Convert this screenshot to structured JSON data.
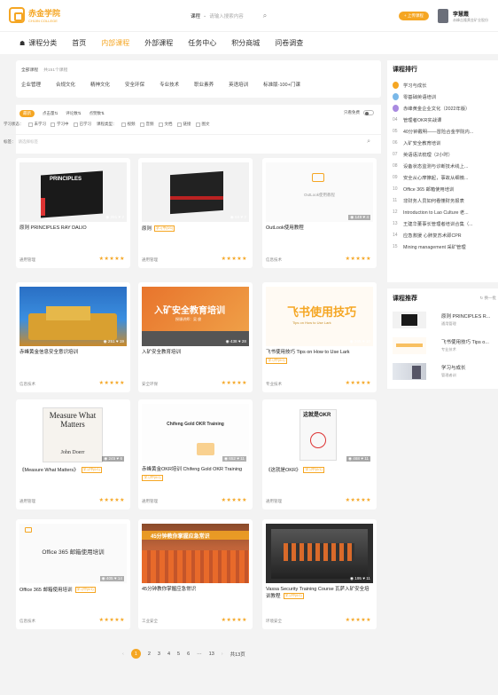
{
  "header": {
    "logo_title": "赤金学院",
    "logo_sub": "CHIJIN COLLEGE",
    "search_scope": "课程",
    "search_placeholder": "请输入搜索内容",
    "live_button": "+ 上传课程",
    "user_name": "李慧霞",
    "user_org": "赤峰吉隆黄金矿业股份"
  },
  "nav": {
    "items": [
      "课程分类",
      "首页",
      "内部课程",
      "外部课程",
      "任务中心",
      "积分商城",
      "问卷调查"
    ]
  },
  "filter": {
    "all_label": "全部课程",
    "count_text": "共151个课程",
    "categories": [
      "企业管理",
      "合规文化",
      "精神文化",
      "安全环保",
      "专业技术",
      "职业素养",
      "英语培训",
      "标准版-100+门课"
    ]
  },
  "sort": {
    "options": [
      "最新",
      "点击量⇅",
      "评论数⇅",
      "点赞数⇅"
    ],
    "only_free": "只看免费",
    "status_label": "学习状态：",
    "status_options": [
      "未学习",
      "学习中",
      "已学习"
    ],
    "type_label": "课程类型：",
    "type_options": [
      "视频",
      "音频",
      "文档",
      "链接",
      "图文"
    ],
    "tag_label": "标签：",
    "tag_placeholder": "请选择标签"
  },
  "courses": [
    {
      "title": "原则 PRINCIPLES RAY DALIO",
      "tag": "",
      "category": "通用管理",
      "views": "291",
      "likes": "2",
      "rating": 5
    },
    {
      "title": "原则",
      "tag": "学习中(0/1)",
      "category": "通用管理",
      "views": "66",
      "likes": "2",
      "rating": 5
    },
    {
      "title": "OutLook使用教程",
      "tag": "",
      "category": "信息技术",
      "views": "149",
      "likes": "4",
      "rating": 5
    },
    {
      "title": "赤峰黄金信息安全意识培训",
      "tag": "",
      "category": "信息技术",
      "views": "251",
      "likes": "19",
      "rating": 5
    },
    {
      "title": "入矿安全教育培训",
      "tag": "",
      "category": "安全环保",
      "views": "438",
      "likes": "28",
      "rating": 5
    },
    {
      "title": "飞书使用技巧 Tips on How to Use Lark",
      "tag": "学习中(0/1)",
      "category": "专业技术",
      "views": "265",
      "likes": "10",
      "rating": 5
    },
    {
      "title": "《Measure What Matters》",
      "tag": "学习中(0/1)",
      "category": "通用管理",
      "views": "245",
      "likes": "6",
      "rating": 5
    },
    {
      "title": "赤峰黄金OKR培训 Chifeng Gold OKR Training",
      "tag": "学习中(0/1)",
      "category": "通用管理",
      "views": "652",
      "likes": "11",
      "rating": 5
    },
    {
      "title": "《这就是OKR》",
      "tag": "学习中(0/1)",
      "category": "通用管理",
      "views": "468",
      "likes": "11",
      "rating": 5
    },
    {
      "title": "Office 365 邮箱使用培训",
      "tag": "学习中(0/1)",
      "category": "信息技术",
      "views": "405",
      "likes": "14",
      "rating": 5
    },
    {
      "title": "45分钟教你掌握应急常识",
      "tag": "",
      "category": "工业安全",
      "views": "",
      "likes": "",
      "rating": 5
    },
    {
      "title": "Vassa Security Training Course 瓦萨入矿安全培训教程",
      "tag": "学习中(0/1)",
      "category": "环境安全",
      "views": "195",
      "likes": "11",
      "rating": 5
    }
  ],
  "thumb_text": {
    "c1": "PRINCIPLES",
    "c3": "OutLook使用教程",
    "c5": "入矿安全教育培训",
    "c5_sub": "授课讲师：吴  俊",
    "c6": "飞书使用技巧",
    "c6_sub": "Tips on How to Use Lark",
    "c7": "Measure What Matters",
    "c7_author": "John Doerr",
    "c8": "Chifeng Gold OKR Training",
    "c9": "这就是OKR",
    "c10": "Office 365 邮箱使用培训",
    "c11": "45分钟教你掌握应急常识"
  },
  "pagination": {
    "pages": [
      "1",
      "2",
      "3",
      "4",
      "5",
      "6",
      "···",
      "13"
    ],
    "total": "共13页"
  },
  "ranking": {
    "title": "课程排行",
    "items": [
      "学习与成长",
      "零基础英语培训",
      "赤峰黄金企业文化（2022年版）",
      "管理者OKR实战课",
      "40分钟戴明——冒险合金学院内...",
      "入矿安全教育培训",
      "英语语法梳理（2小时）",
      "设备状态监测与诊断技术线上...",
      "安全从心摩擦起，事故从细微...",
      "Office 365 邮箱使用培训",
      "非财务人员如何看懂财务报表",
      "Introduction to Lao Culture 老...",
      "王建华董事长管理者培训合集（...",
      "应急救援 心肺复苏术即CPR",
      "Mining management 采矿管理"
    ],
    "numbers": [
      "04",
      "05",
      "06",
      "07",
      "08",
      "09",
      "10",
      "11",
      "12",
      "13",
      "14",
      "15"
    ]
  },
  "recommend": {
    "title": "课程推荐",
    "more": "换一批",
    "items": [
      {
        "name": "原则 PRINCIPLES R...",
        "category": "通用管理"
      },
      {
        "name": "飞书使用技巧 Tips o...",
        "category": "专业技术"
      },
      {
        "name": "学习与成长",
        "category": "管理者训"
      }
    ]
  },
  "colors": {
    "accent": "#f5a623",
    "page_bg": "#f3f3f3"
  }
}
